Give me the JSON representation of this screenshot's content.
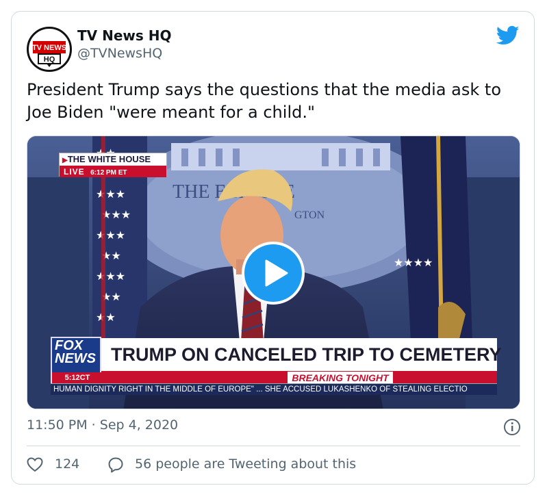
{
  "account": {
    "name": "TV News HQ",
    "handle": "@TVNewsHQ",
    "avatar_text_top": "TV NEWS",
    "avatar_text_bottom": "HQ"
  },
  "tweet": {
    "text": "President Trump says the questions that the media ask to Joe Biden \"were meant for a child.\"",
    "timestamp": "11:50 PM · Sep 4, 2020"
  },
  "video": {
    "location_label": "THE WHITE HOUSE",
    "live_label": "LIVE",
    "live_time": "6:12 PM ET",
    "backdrop_text": "THE      E HOUSE",
    "backdrop_subtext": "GTON",
    "network_top": "FOX",
    "network_bottom": "NEWS",
    "network_time": "5:12CT",
    "headline": "TRUMP ON CANCELED TRIP TO CEMETERY",
    "breaking": "BREAKING TONIGHT",
    "ticker": "HUMAN DIGNITY RIGHT IN THE MIDDLE OF EUROPE\" ...  SHE ACCUSED LUKASHENKO OF STEALING ELECTIO"
  },
  "actions": {
    "like_count": "124",
    "reply_text": "56 people are Tweeting about this"
  },
  "colors": {
    "twitter_blue": "#1d9bf0",
    "secondary_text": "#536471",
    "fox_red": "#c8102e",
    "fox_blue": "#1a3a8a"
  },
  "icons": [
    "twitter-bird-icon",
    "play-icon",
    "info-icon",
    "heart-icon",
    "reply-bubble-icon"
  ]
}
